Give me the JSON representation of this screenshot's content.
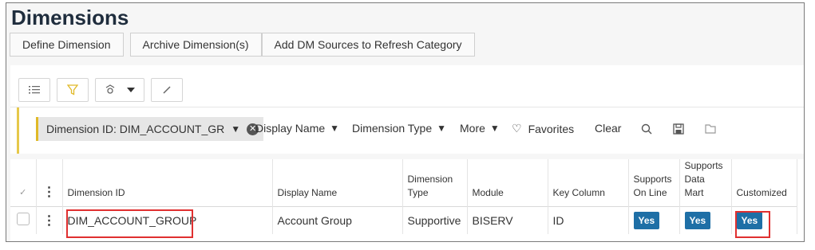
{
  "page": {
    "title": "Dimensions"
  },
  "commands": [
    "Define Dimension",
    "Archive Dimension(s)",
    "Add DM Sources to Refresh Category"
  ],
  "toolbar": {
    "icons": [
      "list-details-icon",
      "filter-icon",
      "settings-view-icon",
      "chevron-down-icon",
      "edit-icon"
    ]
  },
  "filter": {
    "chip_label": "Dimension ID: DIM_ACCOUNT_GR",
    "fields": [
      "Display Name",
      "Dimension Type",
      "More"
    ],
    "favorites": "Favorites",
    "clear": "Clear"
  },
  "grid": {
    "columns": {
      "dimension_id": "Dimension ID",
      "display_name": "Display Name",
      "dimension_type": "Dimension Type",
      "module": "Module",
      "key_column": "Key Column",
      "supports_on_line": "Supports On Line",
      "supports_data_mart": "Supports Data Mart",
      "customized": "Customized"
    },
    "rows": [
      {
        "dimension_id": "DIM_ACCOUNT_GROUP",
        "display_name": "Account Group",
        "dimension_type": "Supportive",
        "module": "BISERV",
        "key_column": "ID",
        "supports_on_line": "Yes",
        "supports_data_mart": "Yes",
        "customized": "Yes"
      }
    ]
  },
  "colors": {
    "accent_yes": "#1e6fa6",
    "highlight": "#e03030",
    "filter_accent": "#e6c84a"
  }
}
